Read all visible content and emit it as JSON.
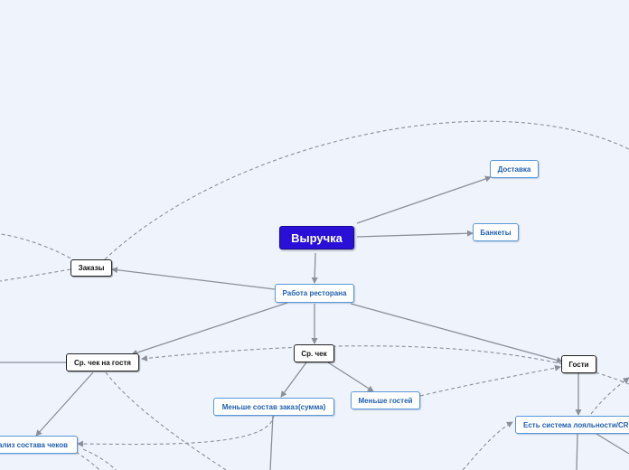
{
  "mindmap": {
    "central": "Выручка",
    "nodes": {
      "delivery": "Доставка",
      "banquets": "Банкеты",
      "restaurant_work": "Работа ресторана",
      "orders": "Заказы",
      "avg_check_guest": "Ср. чек на гостя",
      "avg_check": "Ср. чек",
      "guests": "Гости",
      "smaller_order": "Меньше состав заказ(сумма)",
      "fewer_guests": "Меньше гостей",
      "loyalty": "Есть система лояльности/CRM",
      "check_analysis": "нализ состава чеков"
    }
  },
  "colors": {
    "central_fill": "#2a0fd6",
    "node_border": "#5a97d8",
    "node_text": "#1f5fb0",
    "connector": "#8a8f99",
    "background": "#eef3fc"
  }
}
